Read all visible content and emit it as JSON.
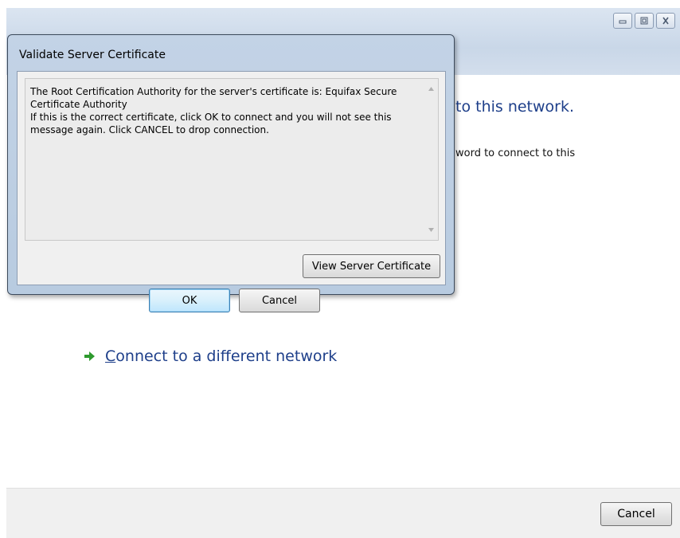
{
  "background_window": {
    "heading_text": "to this network.",
    "body_text": "word to connect to this",
    "link_text_first_letter": "C",
    "link_text_rest": "onnect to a different network",
    "footer_cancel_label": "Cancel",
    "controls": [
      "minimize-icon",
      "maximize-icon",
      "close-icon"
    ],
    "link_arrow_icon": "green-arrow-icon",
    "accent_color": "#1e3f8a",
    "arrow_color": "#2e9a2e"
  },
  "dialog": {
    "title": "Validate Server Certificate",
    "message_line1": "The Root Certification Authority for the server's certificate is: Equifax Secure Certificate Authority",
    "message_line2": "If this is the correct certificate, click OK to connect and you will not see this message again.  Click CANCEL to drop connection.",
    "view_certificate_label": "View Server Certificate",
    "ok_label": "OK",
    "cancel_label": "Cancel"
  }
}
